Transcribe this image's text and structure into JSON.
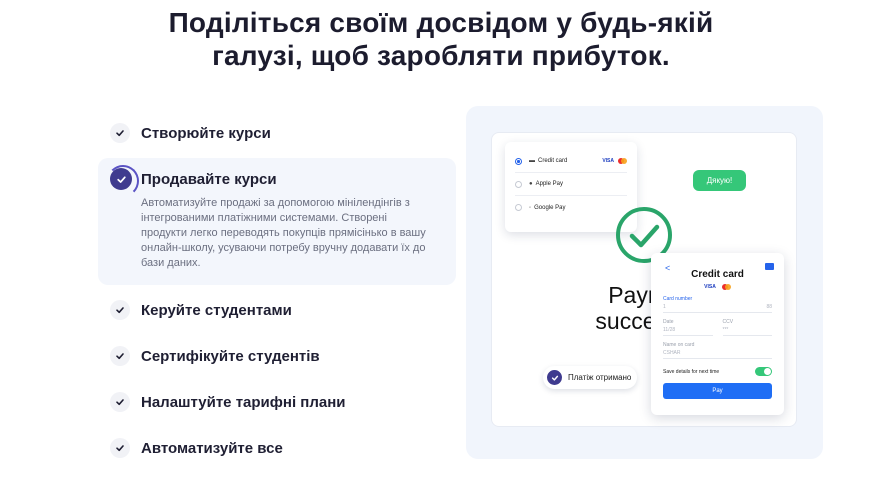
{
  "headline": {
    "line1": "Поділіться своїм досвідом у будь-якій",
    "line2": "галузі, щоб заробляти прибуток."
  },
  "features": [
    {
      "label": "Створюйте курси"
    },
    {
      "label": "Продавайте курси",
      "description": "Автоматизуйте продажі за допомогою мінілендінгів з інтегрованими платіжними системами. Створені продукти легко переводять покупців прямісінько в вашу онлайн-школу, усуваючи потребу вручну додавати їх до бази даних."
    },
    {
      "label": "Керуйте студентами"
    },
    {
      "label": "Сертифікуйте студентів"
    },
    {
      "label": "Налаштуйте тарифні плани"
    },
    {
      "label": "Автоматизуйте все"
    }
  ],
  "showcase": {
    "payment_methods": [
      {
        "label": "Credit card",
        "selected": true,
        "brands": [
          "VISA"
        ]
      },
      {
        "label": "Apple Pay",
        "selected": false
      },
      {
        "label": "Google Pay",
        "selected": false
      }
    ],
    "chat_bubble": "Дякую!",
    "big_text_line1": "Paym",
    "big_text_line2": "succes",
    "received_badge": "Платіж отримано",
    "card_form": {
      "title": "Credit card",
      "brand": "VISA",
      "card_number_label": "Card number",
      "card_number_placeholder": "1",
      "card_number_suffix": "88",
      "date_label": "Date",
      "date_placeholder": "11/28",
      "ccv_label": "CCV",
      "ccv_placeholder": "***",
      "name_label": "Name on card",
      "name_placeholder": "CSHAR",
      "save_label": "Save details for next time",
      "save_enabled": true,
      "pay_label": "Pay"
    },
    "colors": {
      "accent_purple": "#3f3b8f",
      "success_green": "#35c779",
      "pay_blue": "#1f6ef5",
      "panel_bg": "#f1f5fc"
    }
  }
}
